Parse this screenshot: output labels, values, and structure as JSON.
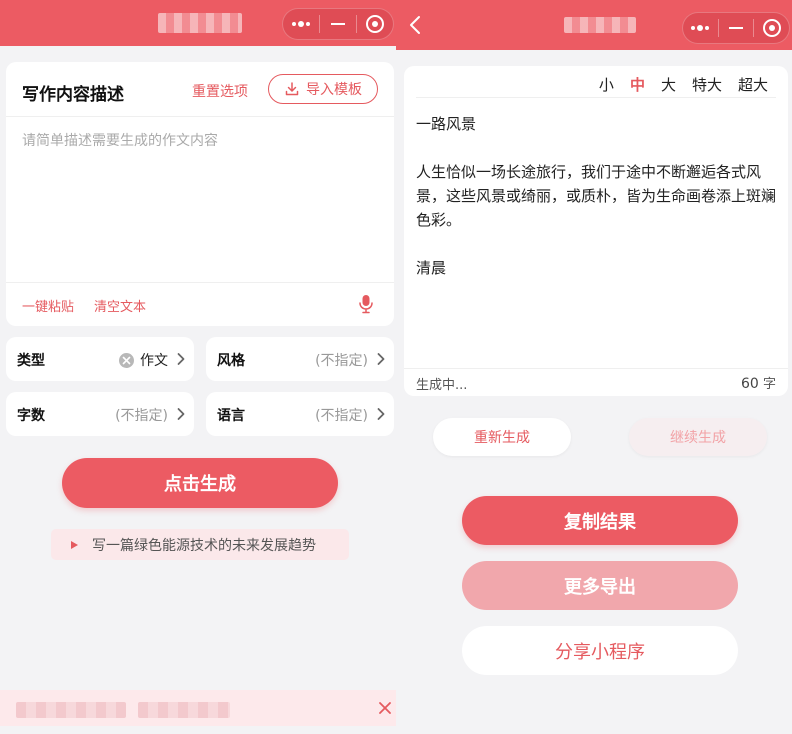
{
  "colors": {
    "accent": "#ec5b63",
    "accent_text": "#e55a5f",
    "muted_accent": "#f1a7ac",
    "background": "#f3f3f5"
  },
  "left": {
    "capsule_icons": [
      "more-dots-icon",
      "minimize-icon",
      "target-circle-icon"
    ],
    "desc_card": {
      "title": "写作内容描述",
      "reset_label": "重置选项",
      "import_label": "导入模板",
      "placeholder": "请简单描述需要生成的作文内容",
      "paste_label": "一键粘贴",
      "clear_label": "清空文本"
    },
    "options": {
      "type": {
        "label": "类型",
        "value": "作文"
      },
      "style": {
        "label": "风格",
        "value": "(不指定)"
      },
      "words": {
        "label": "字数",
        "value": "(不指定)"
      },
      "language": {
        "label": "语言",
        "value": "(不指定)"
      }
    },
    "generate_label": "点击生成",
    "suggestion": "写一篇绿色能源技术的未来发展趋势"
  },
  "right": {
    "font_sizes": [
      "小",
      "中",
      "大",
      "特大",
      "超大"
    ],
    "selected_font_size": "中",
    "result_text": "一路风景\n\n人生恰似一场长途旅行，我们于途中不断邂逅各式风景，这些风景或绮丽，或质朴，皆为生命画卷添上斑斓色彩。\n\n清晨",
    "status": "生成中...",
    "count": "60",
    "count_unit": "字",
    "regenerate_label": "重新生成",
    "continue_label": "继续生成",
    "copy_label": "复制结果",
    "more_export_label": "更多导出",
    "share_label": "分享小程序"
  }
}
